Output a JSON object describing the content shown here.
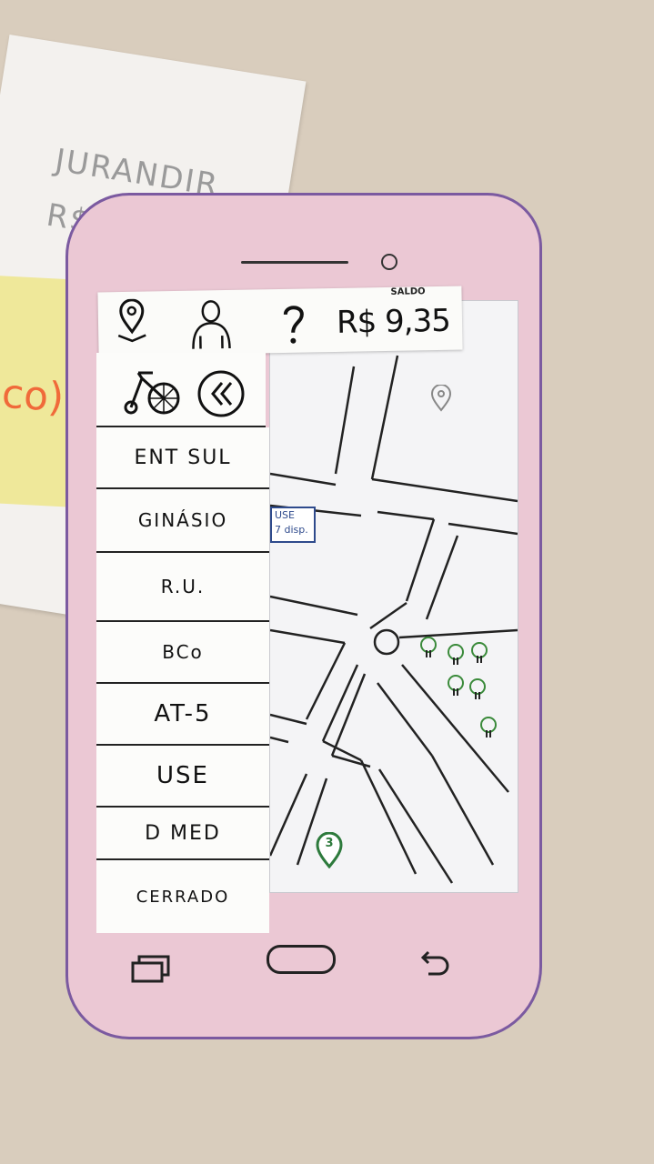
{
  "background": {
    "paper_text_line1": "JURANDIR",
    "paper_text_line2": "R$",
    "sticky_text": "co)"
  },
  "topbar": {
    "icons": [
      "map-pin-icon",
      "user-icon",
      "help-icon"
    ],
    "balance_label": "SALDO",
    "balance_value": "R$ 9,35"
  },
  "menu": {
    "header_icons": [
      "bicycle-icon",
      "collapse-icon"
    ],
    "items": [
      "ENT SUL",
      "GINÁSIO",
      "R.U.",
      "BCo",
      "AT-5",
      "USE",
      "D MED",
      "CERRADO"
    ]
  },
  "map": {
    "station_tooltip_line1": "USE",
    "station_tooltip_line2": "7 disp.",
    "marker_number": "3"
  },
  "colors": {
    "phone_body": "#ebc8d4",
    "phone_outline": "#7b5aa0",
    "marker_green": "#2d7a3c"
  }
}
